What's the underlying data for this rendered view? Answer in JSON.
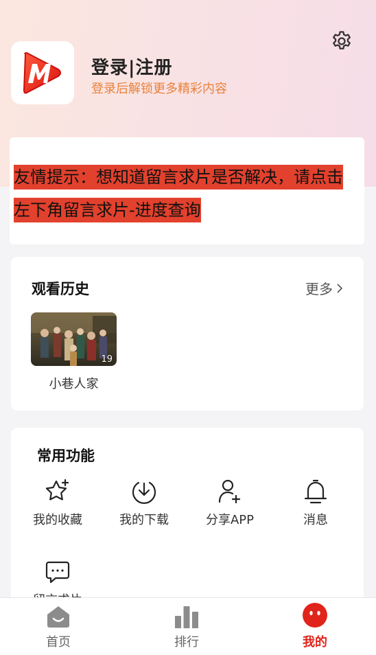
{
  "header": {
    "login_title": "登录|注册",
    "login_subtitle": "登录后解锁更多精彩内容"
  },
  "notice": {
    "line1": "友情提示：想知道留言求片是否解决，请点击",
    "line2": "左下角留言求片-进度查询"
  },
  "history": {
    "title": "观看历史",
    "more_label": "更多",
    "items": [
      {
        "title": "小巷人家",
        "episode": "19"
      }
    ]
  },
  "functions": {
    "title": "常用功能",
    "items": [
      {
        "label": "我的收藏",
        "icon": "star-plus-icon"
      },
      {
        "label": "我的下载",
        "icon": "download-icon"
      },
      {
        "label": "分享APP",
        "icon": "share-user-icon"
      },
      {
        "label": "消息",
        "icon": "bell-icon"
      },
      {
        "label": "留言求片",
        "icon": "chat-icon"
      }
    ]
  },
  "tabbar": {
    "items": [
      {
        "label": "首页",
        "icon": "home-icon",
        "active": false
      },
      {
        "label": "排行",
        "icon": "ranking-icon",
        "active": false
      },
      {
        "label": "我的",
        "icon": "mine-face-icon",
        "active": true
      }
    ]
  },
  "colors": {
    "accent": "#e0241b",
    "subtitle": "#e8823c",
    "notice_highlight": "#e2412d"
  }
}
